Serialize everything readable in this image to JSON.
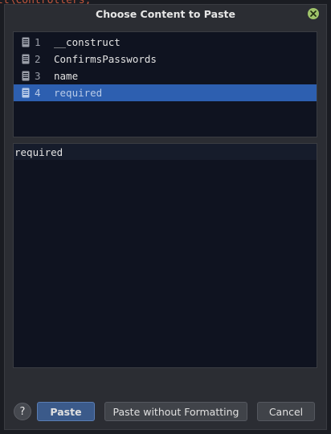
{
  "background": {
    "code_text": "tt\\Controllers;"
  },
  "dialog": {
    "title": "Choose Content to Paste",
    "close_icon": "close-icon",
    "accent_color": "#9fc36a"
  },
  "items": [
    {
      "number": "1",
      "label": "__construct",
      "selected": false
    },
    {
      "number": "2",
      "label": "ConfirmsPasswords",
      "selected": false
    },
    {
      "number": "3",
      "label": "name",
      "selected": false
    },
    {
      "number": "4",
      "label": "required",
      "selected": true
    }
  ],
  "preview": {
    "text": "required"
  },
  "footer": {
    "help_label": "?",
    "paste_label": "Paste",
    "paste_without_formatting_label": "Paste without Formatting",
    "cancel_label": "Cancel"
  },
  "colors": {
    "selection": "#2d5fb0",
    "panel_bg": "#0f1320",
    "primary_button": "#3b5a8a"
  }
}
